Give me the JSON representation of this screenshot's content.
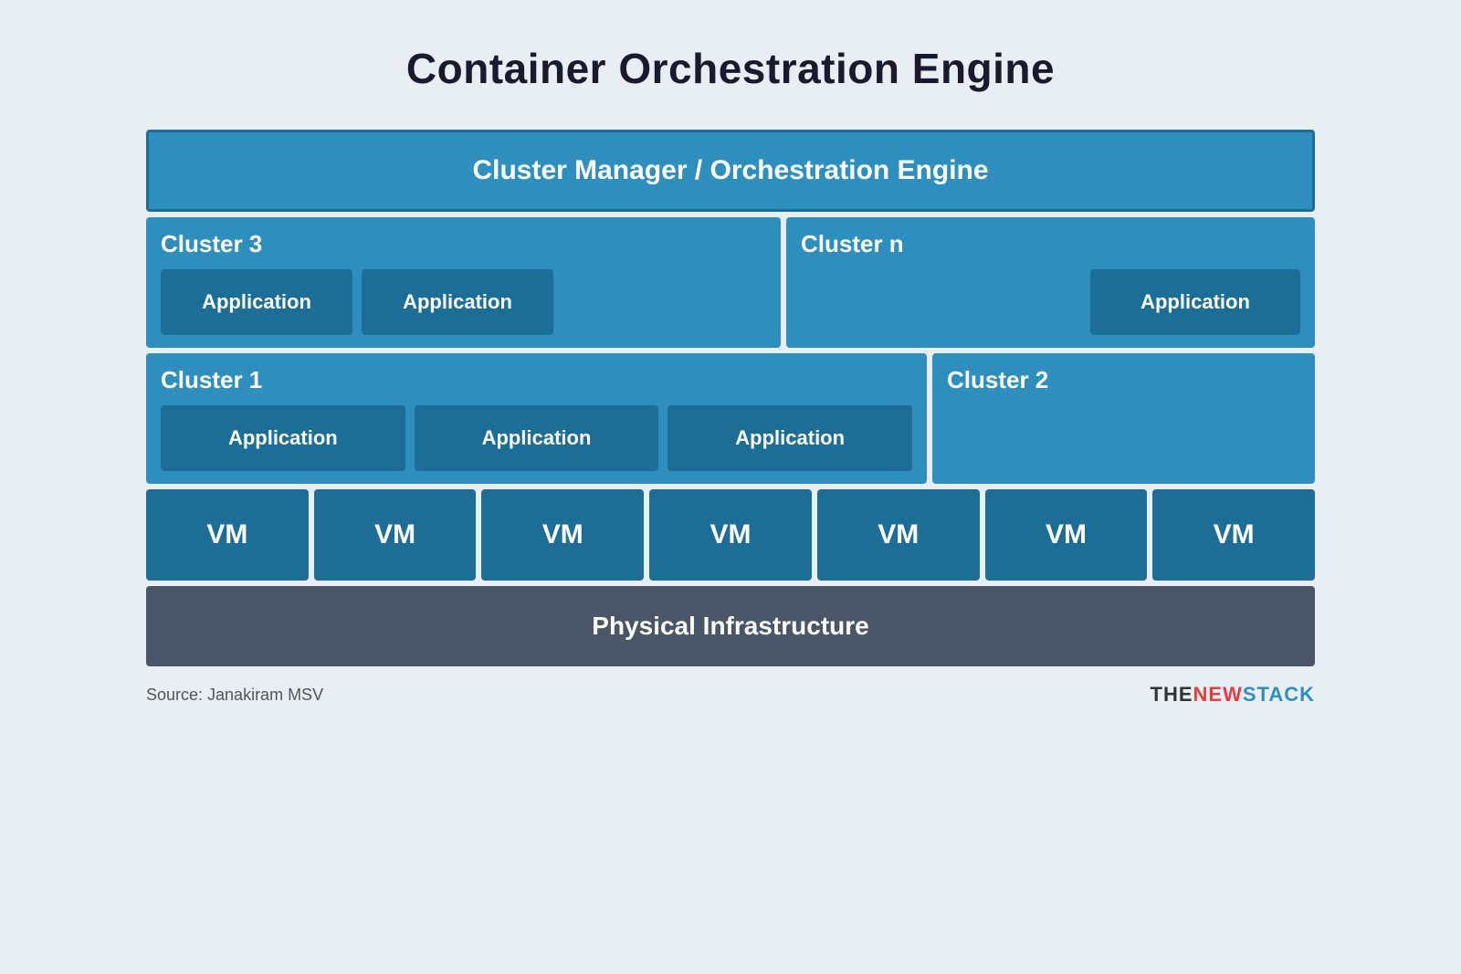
{
  "title": "Container Orchestration Engine",
  "cluster_manager": {
    "label": "Cluster Manager / Orchestration Engine"
  },
  "cluster3": {
    "name": "Cluster 3",
    "apps": [
      "Application",
      "Application"
    ]
  },
  "clustern": {
    "name": "Cluster n",
    "apps": [
      "Application"
    ]
  },
  "cluster1": {
    "name": "Cluster 1",
    "apps": [
      "Application",
      "Application",
      "Application"
    ]
  },
  "cluster2": {
    "name": "Cluster 2",
    "apps": []
  },
  "vms": [
    "VM",
    "VM",
    "VM",
    "VM",
    "VM",
    "VM",
    "VM"
  ],
  "physical_infra": {
    "label": "Physical Infrastructure"
  },
  "footer": {
    "source": "Source: Janakiram MSV",
    "brand_the": "THE",
    "brand_new": "NEW",
    "brand_stack": "STACK"
  }
}
